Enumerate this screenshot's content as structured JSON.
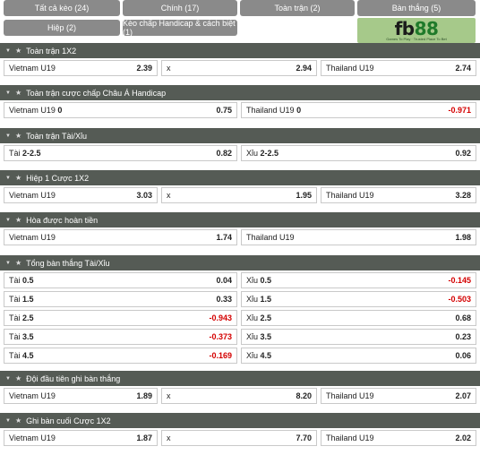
{
  "tabs": [
    {
      "label": "Tất cả kèo (24)",
      "active": true
    },
    {
      "label": "Chính (17)",
      "active": false
    },
    {
      "label": "Toàn trận (2)",
      "active": false
    },
    {
      "label": "Bàn thắng (5)",
      "active": false
    },
    {
      "label": "Hiệp (2)",
      "active": false
    },
    {
      "label": "Kèo chấp Handicap & cách biệt (1)",
      "active": false
    }
  ],
  "logo": {
    "fb": "fb",
    "num": "88",
    "tagline": "Games To Play · Trusted Place To Bet"
  },
  "colors": {
    "active_tab": "#2f3e34",
    "tab": "#8a8a8a",
    "header": "#555b55",
    "negative": "#d40000",
    "logo_bg": "#a6c98a"
  },
  "markets": [
    {
      "title": "Toàn trận 1X2",
      "rows": [
        [
          {
            "label": "Vietnam U19",
            "line": "",
            "odds": "2.39"
          },
          {
            "label": "x",
            "line": "",
            "odds": "2.94"
          },
          {
            "label": "Thailand U19",
            "line": "",
            "odds": "2.74"
          }
        ]
      ]
    },
    {
      "title": "Toàn trận cược chấp Châu Á Handicap",
      "rows": [
        [
          {
            "label": "Vietnam U19",
            "line": "0",
            "odds": "0.75"
          },
          {
            "label": "Thailand U19",
            "line": "0",
            "odds": "-0.971"
          }
        ]
      ]
    },
    {
      "title": "Toàn trận Tài/Xỉu",
      "rows": [
        [
          {
            "label": "Tài",
            "line": "2-2.5",
            "odds": "0.82"
          },
          {
            "label": "Xỉu",
            "line": "2-2.5",
            "odds": "0.92"
          }
        ]
      ]
    },
    {
      "title": "Hiệp 1 Cược 1X2",
      "rows": [
        [
          {
            "label": "Vietnam U19",
            "line": "",
            "odds": "3.03"
          },
          {
            "label": "x",
            "line": "",
            "odds": "1.95"
          },
          {
            "label": "Thailand U19",
            "line": "",
            "odds": "3.28"
          }
        ]
      ]
    },
    {
      "title": "Hòa được hoàn tiền",
      "rows": [
        [
          {
            "label": "Vietnam U19",
            "line": "",
            "odds": "1.74"
          },
          {
            "label": "Thailand U19",
            "line": "",
            "odds": "1.98"
          }
        ]
      ]
    },
    {
      "title": "Tổng bàn thắng Tài/Xỉu",
      "rows": [
        [
          {
            "label": "Tài",
            "line": "0.5",
            "odds": "0.04"
          },
          {
            "label": "Xỉu",
            "line": "0.5",
            "odds": "-0.145"
          }
        ],
        [
          {
            "label": "Tài",
            "line": "1.5",
            "odds": "0.33"
          },
          {
            "label": "Xỉu",
            "line": "1.5",
            "odds": "-0.503"
          }
        ],
        [
          {
            "label": "Tài",
            "line": "2.5",
            "odds": "-0.943"
          },
          {
            "label": "Xỉu",
            "line": "2.5",
            "odds": "0.68"
          }
        ],
        [
          {
            "label": "Tài",
            "line": "3.5",
            "odds": "-0.373"
          },
          {
            "label": "Xỉu",
            "line": "3.5",
            "odds": "0.23"
          }
        ],
        [
          {
            "label": "Tài",
            "line": "4.5",
            "odds": "-0.169"
          },
          {
            "label": "Xỉu",
            "line": "4.5",
            "odds": "0.06"
          }
        ]
      ]
    },
    {
      "title": "Đội đầu tiên ghi bàn thắng",
      "rows": [
        [
          {
            "label": "Vietnam U19",
            "line": "",
            "odds": "1.89"
          },
          {
            "label": "x",
            "line": "",
            "odds": "8.20"
          },
          {
            "label": "Thailand U19",
            "line": "",
            "odds": "2.07"
          }
        ]
      ]
    },
    {
      "title": "Ghi bàn cuối Cược 1X2",
      "rows": [
        [
          {
            "label": "Vietnam U19",
            "line": "",
            "odds": "1.87"
          },
          {
            "label": "x",
            "line": "",
            "odds": "7.70"
          },
          {
            "label": "Thailand U19",
            "line": "",
            "odds": "2.02"
          }
        ]
      ]
    }
  ]
}
